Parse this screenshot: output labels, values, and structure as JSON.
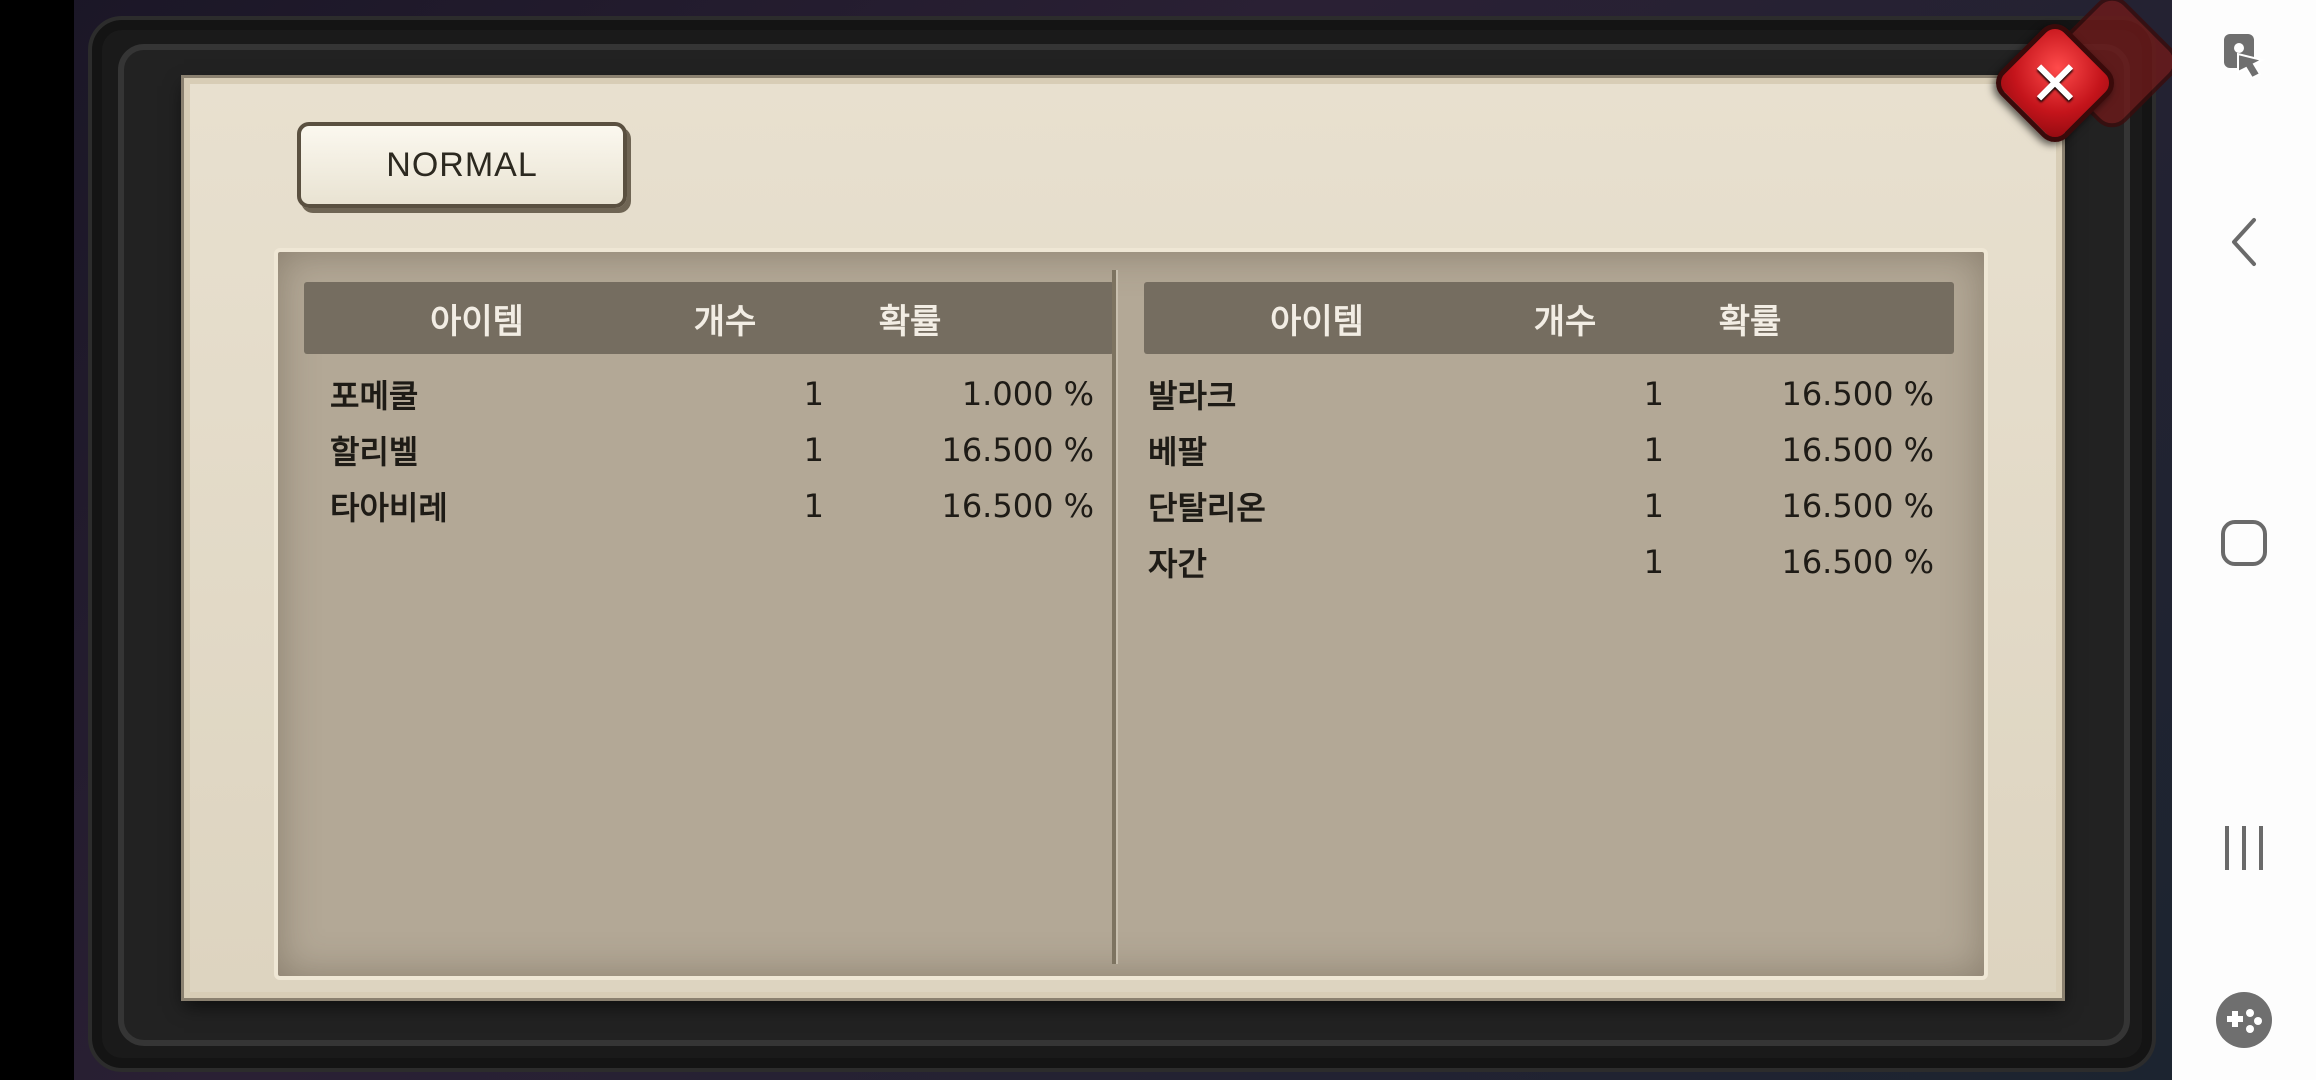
{
  "dialog": {
    "tab_label": "NORMAL",
    "close_icon": "close-icon",
    "left_table": {
      "headers": {
        "item": "아이템",
        "count": "개수",
        "probability": "확률"
      },
      "rows": [
        {
          "item": "포메쿨",
          "count": "1",
          "probability": "1.000 %"
        },
        {
          "item": "할리벨",
          "count": "1",
          "probability": "16.500 %"
        },
        {
          "item": "타아비레",
          "count": "1",
          "probability": "16.500 %"
        }
      ]
    },
    "right_table": {
      "headers": {
        "item": "아이템",
        "count": "개수",
        "probability": "확률"
      },
      "rows": [
        {
          "item": "발라크",
          "count": "1",
          "probability": "16.500 %"
        },
        {
          "item": "베팔",
          "count": "1",
          "probability": "16.500 %"
        },
        {
          "item": "단탈리온",
          "count": "1",
          "probability": "16.500 %"
        },
        {
          "item": "자간",
          "count": "1",
          "probability": "16.500 %"
        }
      ]
    }
  },
  "navbar": {
    "icons": [
      "touch-lock-icon",
      "back-icon",
      "home-icon",
      "recents-icon",
      "game-tools-icon"
    ]
  },
  "colors": {
    "dialog_bg": "#e8e0cf",
    "panel_bg": "#b3a896",
    "header_bg": "#756d60",
    "close_red": "#c4141b"
  }
}
